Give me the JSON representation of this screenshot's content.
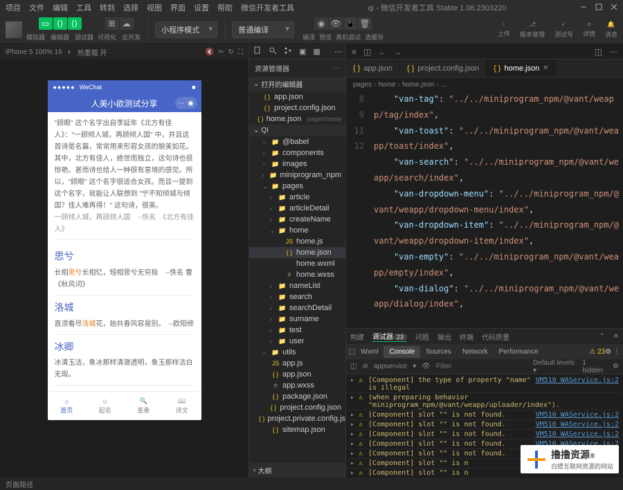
{
  "titlebar": {
    "menus": [
      "项目",
      "文件",
      "编辑",
      "工具",
      "转到",
      "选择",
      "视图",
      "界面",
      "设置",
      "帮助",
      "微信开发者工具"
    ],
    "title": "qi - 微信开发者工具 Stable 1.06.2303220"
  },
  "toolbar": {
    "mode_labels": [
      "模拟器",
      "编辑器",
      "调试器",
      "可视化",
      "云开发"
    ],
    "select1": "小程序模式",
    "select2": "普通编译",
    "action_labels": [
      "编译",
      "预览",
      "真机调试",
      "清缓存"
    ],
    "right_labels": [
      "上传",
      "版本管理",
      "测试号",
      "详情",
      "消息"
    ]
  },
  "simulator": {
    "device": "iPhone 5 100% 16",
    "hot": "热重载 开",
    "wechat": "WeChat",
    "nav_title": "人美小欲测试分享",
    "quote": "\"顾眼\" 这个名字出自李延年《北方有佳人》：\"一顾倾人城，再顾倾人国\" 中，并且这首诗是名篇，常常用来形容女孩的貌美如花。其中，北方有佳人，绝世而独立，这句诗也很惊艳。甚而诗也给人一种很有意境的感觉。所以，\"顾眼\" 这个名字很适合女孩。而且一提到这个名字，就能让人联想到 \"宁不知倾城与倾国？佳人难再得！\" 这句诗，很美。",
    "quote_src": "一顾倾人城，再顾倾人国　--佚名　《北方有佳人》",
    "cards": [
      {
        "title": "思兮",
        "body": "长相",
        "hl": "思兮",
        "body2": "长相忆，短相思兮无穷极　--佚名 曹 《秋风词》"
      },
      {
        "title": "洛城",
        "body": "直须看尽",
        "hl": "洛城",
        "body2": "花，始共春风容易别。　--欧阳修"
      },
      {
        "title": "冰卿",
        "body": "冰清玉洁，象冰那样清澈透明，象玉那样洁白无瑕。"
      }
    ],
    "tabs": [
      "首页",
      "起名",
      "查重",
      "诗文"
    ]
  },
  "explorer": {
    "title": "资源管理器",
    "section_open": "打开的编辑器",
    "open_items": [
      {
        "name": "app.json",
        "type": "json"
      },
      {
        "name": "project.config.json",
        "type": "json"
      },
      {
        "name": "home.json",
        "type": "json",
        "meta": "pages\\home"
      }
    ],
    "root": "QI",
    "tree": [
      {
        "name": "@babel",
        "type": "folder",
        "depth": 1,
        "chev": "›"
      },
      {
        "name": "components",
        "type": "folder",
        "depth": 1,
        "chev": "›"
      },
      {
        "name": "images",
        "type": "folder",
        "depth": 1,
        "chev": "›"
      },
      {
        "name": "miniprogram_npm",
        "type": "folder",
        "depth": 1,
        "chev": "›"
      },
      {
        "name": "pages",
        "type": "folder",
        "depth": 1,
        "chev": "⌄"
      },
      {
        "name": "article",
        "type": "folder",
        "depth": 2,
        "chev": "›"
      },
      {
        "name": "articleDetail",
        "type": "folder",
        "depth": 2,
        "chev": "›"
      },
      {
        "name": "createName",
        "type": "folder",
        "depth": 2,
        "chev": "›"
      },
      {
        "name": "home",
        "type": "folder",
        "depth": 2,
        "chev": "⌄"
      },
      {
        "name": "home.js",
        "type": "js",
        "depth": 3
      },
      {
        "name": "home.json",
        "type": "json",
        "depth": 3,
        "selected": true
      },
      {
        "name": "home.wxml",
        "type": "wxml",
        "depth": 3
      },
      {
        "name": "home.wxss",
        "type": "wxss",
        "depth": 3
      },
      {
        "name": "nameList",
        "type": "folder",
        "depth": 2,
        "chev": "›"
      },
      {
        "name": "search",
        "type": "folder",
        "depth": 2,
        "chev": "›"
      },
      {
        "name": "searchDetail",
        "type": "folder",
        "depth": 2,
        "chev": "›"
      },
      {
        "name": "surname",
        "type": "folder",
        "depth": 2,
        "chev": "›"
      },
      {
        "name": "test",
        "type": "folder",
        "depth": 2,
        "chev": "›"
      },
      {
        "name": "user",
        "type": "folder",
        "depth": 2,
        "chev": "›"
      },
      {
        "name": "utils",
        "type": "folder",
        "depth": 1,
        "chev": "›"
      },
      {
        "name": "app.js",
        "type": "js",
        "depth": 1
      },
      {
        "name": "app.json",
        "type": "json",
        "depth": 1
      },
      {
        "name": "app.wxss",
        "type": "wxss",
        "depth": 1
      },
      {
        "name": "package.json",
        "type": "json",
        "depth": 1
      },
      {
        "name": "project.config.json",
        "type": "json",
        "depth": 1
      },
      {
        "name": "project.private.config.js...",
        "type": "json",
        "depth": 1
      },
      {
        "name": "sitemap.json",
        "type": "json",
        "depth": 1
      }
    ],
    "outline": "大纲"
  },
  "editor": {
    "tabs": [
      {
        "label": "app.json",
        "type": "json"
      },
      {
        "label": "project.config.json",
        "type": "json"
      },
      {
        "label": "home.json",
        "type": "json",
        "active": true
      }
    ],
    "breadcrumb": [
      "pages",
      "home",
      "home.json",
      "..."
    ],
    "lines": [
      {
        "n": "",
        "key": "\"van-tag\"",
        "val": "\"../../miniprogram_npm/@vant/weapp/tag/index\"",
        "comma": true
      },
      {
        "n": "",
        "key": "\"van-toast\"",
        "val": "\"../../miniprogram_npm/@vant/weapp/toast/index\"",
        "comma": true
      },
      {
        "n": "8",
        "key": "\"van-search\"",
        "val": "\"../../miniprogram_npm/@vant/weapp/search/index\"",
        "comma": true
      },
      {
        "n": "9",
        "key": "\"van-dropdown-menu\"",
        "val": "\"../../miniprogram_npm/@vant/weapp/dropdown-menu/index\"",
        "comma": true
      },
      {
        "n": "",
        "key": "\"van-dropdown-item\"",
        "val": "\"../../miniprogram_npm/@vant/weapp/dropdown-item/index\"",
        "comma": true
      },
      {
        "n": "11",
        "key": "\"van-empty\"",
        "val": "\"../../miniprogram_npm/@vant/weapp/empty/index\"",
        "comma": true
      },
      {
        "n": "12",
        "key": "\"van-dialog\"",
        "val": "\"../../miniprogram_npm/@vant/weapp/dialog/index\"",
        "comma": true
      }
    ]
  },
  "panel": {
    "main_tabs": [
      "构建",
      "调试器",
      "问题",
      "输出",
      "终端",
      "代码质量"
    ],
    "main_badge": "23",
    "dev_tabs": [
      "Wxml",
      "Console",
      "Sources",
      "Network",
      "Performance"
    ],
    "warn_count": "23",
    "hidden": "1 hidden",
    "filter_ctx": "appservice",
    "filter_placeholder": "Filter",
    "filter_levels": "Default levels ▾",
    "lines": [
      {
        "msg": "[Component] the type of property \"name\" is illegal",
        "src": "VM510 WAService.js:2"
      },
      {
        "msg": "(when preparing behavior \"miniprogram_npm/@vant/weapp/uploader/index\").",
        "src": ""
      },
      {
        "msg": "[Component] slot \"\" is not found.",
        "src": "VM510 WAService.js:2"
      },
      {
        "msg": "[Component] slot \"\" is not found.",
        "src": "VM510 WAService.js:2"
      },
      {
        "msg": "[Component] slot \"\" is not found.",
        "src": "VM510 WAService.js:2"
      },
      {
        "msg": "[Component] slot \"\" is not found.",
        "src": "VM510 WAService.js:2"
      },
      {
        "msg": "[Component] slot \"\" is not found.",
        "src": "VM510 WAService.js:2"
      },
      {
        "msg": "[Component] slot \"\" is n",
        "src": ""
      },
      {
        "msg": "[Component] slot \"\" is n",
        "src": ""
      }
    ],
    "watermark": {
      "big": "撸撸资源",
      "small": "白嫖互联网资源的网站"
    }
  },
  "statusbar": {
    "left": "页面路径"
  }
}
